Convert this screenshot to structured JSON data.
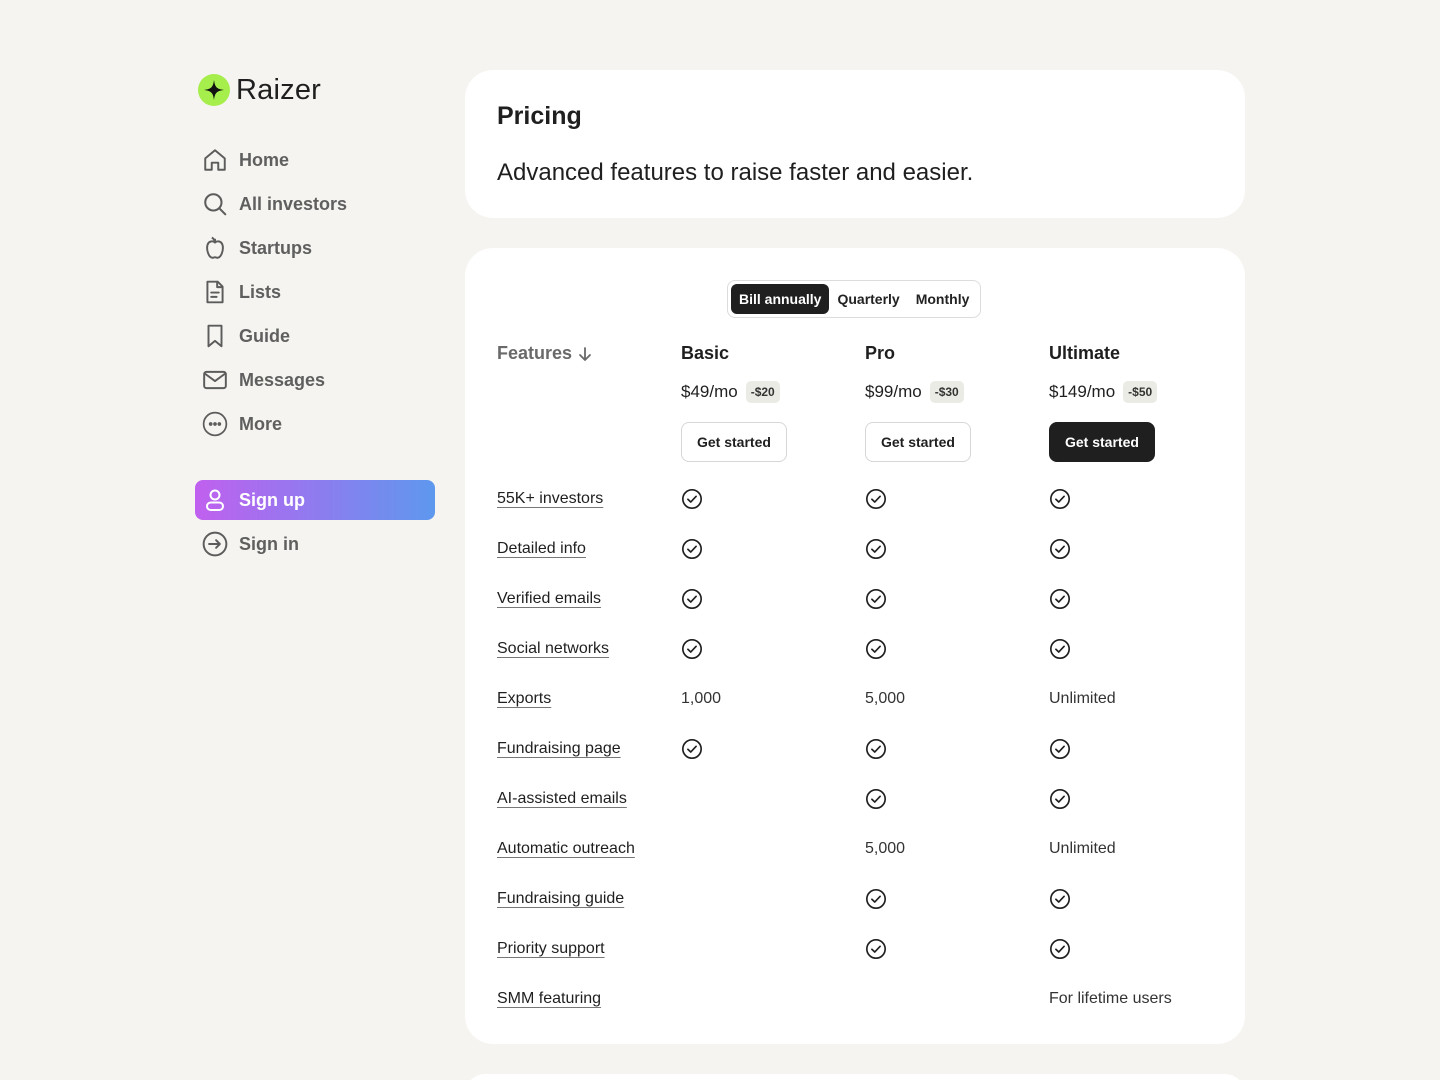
{
  "brand": {
    "name": "Raizer",
    "accent": "#a6ee4c"
  },
  "nav": [
    {
      "label": "Home",
      "icon": "home-icon"
    },
    {
      "label": "All investors",
      "icon": "search-icon"
    },
    {
      "label": "Startups",
      "icon": "apple-icon"
    },
    {
      "label": "Lists",
      "icon": "document-icon"
    },
    {
      "label": "Guide",
      "icon": "bookmark-icon"
    },
    {
      "label": "Messages",
      "icon": "mail-icon"
    },
    {
      "label": "More",
      "icon": "more-icon"
    }
  ],
  "auth": {
    "signup_label": "Sign up",
    "signin_label": "Sign in",
    "signup_gradient": [
      "#c060ef",
      "#5e98ee"
    ]
  },
  "header": {
    "title": "Pricing",
    "subtitle": "Advanced features to raise faster and easier."
  },
  "billing": {
    "options": [
      "Bill annually",
      "Quarterly",
      "Monthly"
    ],
    "selected": "Bill annually"
  },
  "features_label": "Features",
  "plans": [
    {
      "name": "Basic",
      "price": "$49/mo",
      "discount": "-$20",
      "cta": "Get started",
      "primary": false
    },
    {
      "name": "Pro",
      "price": "$99/mo",
      "discount": "-$30",
      "cta": "Get started",
      "primary": false
    },
    {
      "name": "Ultimate",
      "price": "$149/mo",
      "discount": "-$50",
      "cta": "Get started",
      "primary": true
    }
  ],
  "features": [
    {
      "name": "55K+ investors",
      "values": [
        "check",
        "check",
        "check"
      ]
    },
    {
      "name": "Detailed info",
      "values": [
        "check",
        "check",
        "check"
      ]
    },
    {
      "name": "Verified emails",
      "values": [
        "check",
        "check",
        "check"
      ]
    },
    {
      "name": "Social networks",
      "values": [
        "check",
        "check",
        "check"
      ]
    },
    {
      "name": "Exports",
      "values": [
        "1,000",
        "5,000",
        "Unlimited"
      ]
    },
    {
      "name": "Fundraising page",
      "values": [
        "check",
        "check",
        "check"
      ]
    },
    {
      "name": "AI-assisted emails",
      "values": [
        "",
        "check",
        "check"
      ]
    },
    {
      "name": "Automatic outreach",
      "values": [
        "",
        "5,000",
        "Unlimited"
      ]
    },
    {
      "name": "Fundraising guide",
      "values": [
        "",
        "check",
        "check"
      ]
    },
    {
      "name": "Priority support",
      "values": [
        "",
        "check",
        "check"
      ]
    },
    {
      "name": "SMM featuring",
      "values": [
        "",
        "",
        "For lifetime users"
      ]
    }
  ]
}
